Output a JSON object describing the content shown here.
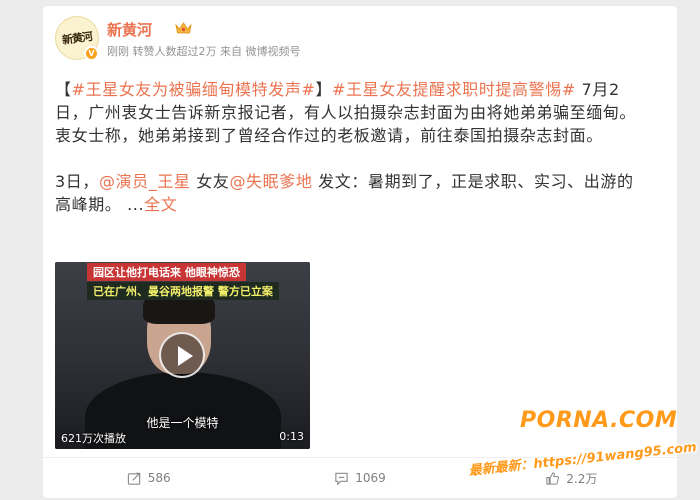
{
  "post": {
    "author": {
      "name": "新黄河",
      "avatar_text": "新黄河",
      "badge": "V"
    },
    "meta": {
      "time": "刚刚",
      "reposts_note": "转赞人数超过2万",
      "source_prefix": "来自",
      "source": "微博视频号"
    },
    "content": {
      "hashtag1": "#王星女友为被骗缅甸模特发声#",
      "bracket_open": "【",
      "bracket_close": "】",
      "hashtag2": "#王星女友提醒求职时提高警惕#",
      "paragraph1": " 7月2日，广州衷女士告诉新京报记者，有人以拍摄杂志封面为由将她弟弟骗至缅甸。衷女士称，她弟弟接到了曾经合作过的老板邀请，前往泰国拍摄杂志封面。",
      "p2_prefix": "3日，",
      "mention1": "@演员_王星",
      "p2_mid": " 女友",
      "mention2": "@失眠爹地",
      "p2_rest": " 发文：暑期到了，正是求职、实习、出游的高峰期。 ...",
      "full_text_link": "全文"
    },
    "video": {
      "caption_top": "园区让他打电话来 他眼神惊恐",
      "caption_second": "已在广州、曼谷两地报警 警方已立案",
      "subtitle": "他是一个模特",
      "play_count": "621万次播放",
      "duration": "0:13"
    },
    "actions": {
      "repost_count": "586",
      "comment_count": "1069",
      "like_count": "2.2万"
    }
  },
  "watermark": {
    "brand": "PORNA.COM",
    "url_line": "最新最新：https://91wang95.com"
  },
  "colors": {
    "accent": "#eb7350",
    "text": "#333333",
    "muted": "#939393",
    "watermark": "#ff9a1a"
  }
}
